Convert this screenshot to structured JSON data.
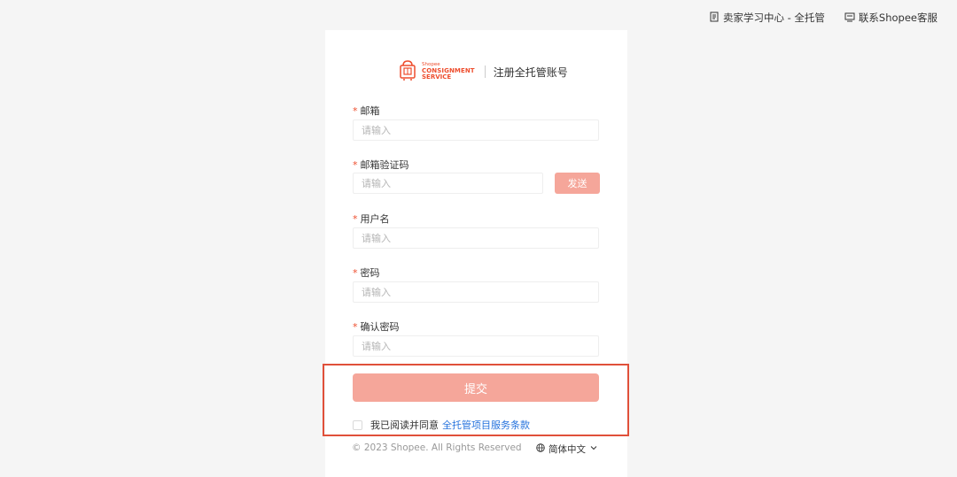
{
  "top_nav": {
    "learning_center": "卖家学习中心 - 全托管",
    "contact_support": "联系Shopee客服"
  },
  "logo": {
    "line1": "Shopee",
    "line2": "CONSIGNMENT",
    "line3": "SERVICE"
  },
  "header": {
    "title": "注册全托管账号"
  },
  "form": {
    "email": {
      "label": "邮箱",
      "placeholder": "请输入"
    },
    "email_code": {
      "label": "邮箱验证码",
      "placeholder": "请输入",
      "send_label": "发送"
    },
    "username": {
      "label": "用户名",
      "placeholder": "请输入"
    },
    "password": {
      "label": "密码",
      "placeholder": "请输入"
    },
    "confirm_password": {
      "label": "确认密码",
      "placeholder": "请输入"
    },
    "required_mark": "*",
    "submit_label": "提交"
  },
  "agreement": {
    "text": "我已阅读并同意",
    "link": "全托管项目服务条款"
  },
  "footer": {
    "copyright": "© 2023 Shopee. All Rights Reserved",
    "language": "简体中文"
  },
  "colors": {
    "brand": "#ee4d2d",
    "button_disabled": "#f5a69a",
    "link": "#2673dd",
    "highlight_border": "#e0503a"
  }
}
